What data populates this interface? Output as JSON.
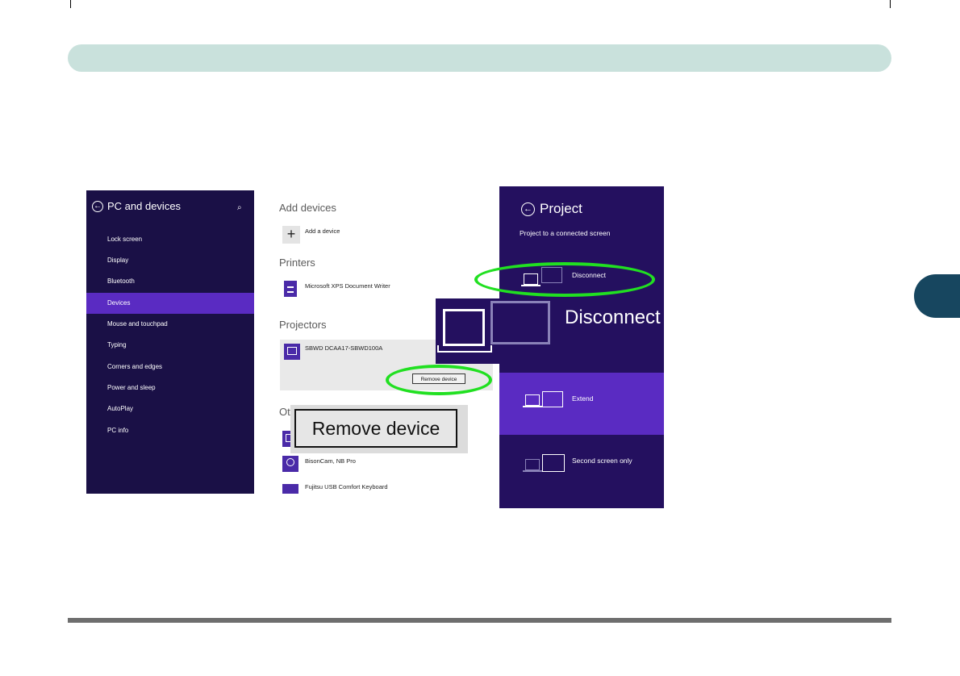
{
  "pc_settings": {
    "title": "PC and devices",
    "nav": [
      "Lock screen",
      "Display",
      "Bluetooth",
      "Devices",
      "Mouse and touchpad",
      "Typing",
      "Corners and edges",
      "Power and sleep",
      "AutoPlay",
      "PC info"
    ],
    "selected": "Devices"
  },
  "devices": {
    "add_header": "Add devices",
    "add_label": "Add a device",
    "printers_header": "Printers",
    "printer": "Microsoft XPS Document Writer",
    "projectors_header": "Projectors",
    "projector": "SBWD DCAA17-SBWD100A",
    "remove_label": "Remove device",
    "other_header_partial": "Ot",
    "other_items": [
      "BisonCam, NB Pro",
      "Fujitsu USB Comfort Keyboard"
    ],
    "zoom_remove_label": "Remove device"
  },
  "project": {
    "title": "Project",
    "subtitle": "Project to a connected screen",
    "options": [
      "Disconnect",
      "Extend",
      "Second screen only"
    ],
    "selected": "Extend",
    "zoom_label": "Disconnect"
  },
  "colors": {
    "header_bar": "#c9e1dc",
    "chapter_tab": "#17465f",
    "highlight_oval": "#21e021",
    "windows_purple": "#24105f",
    "selection_purple": "#5a2bc2"
  }
}
